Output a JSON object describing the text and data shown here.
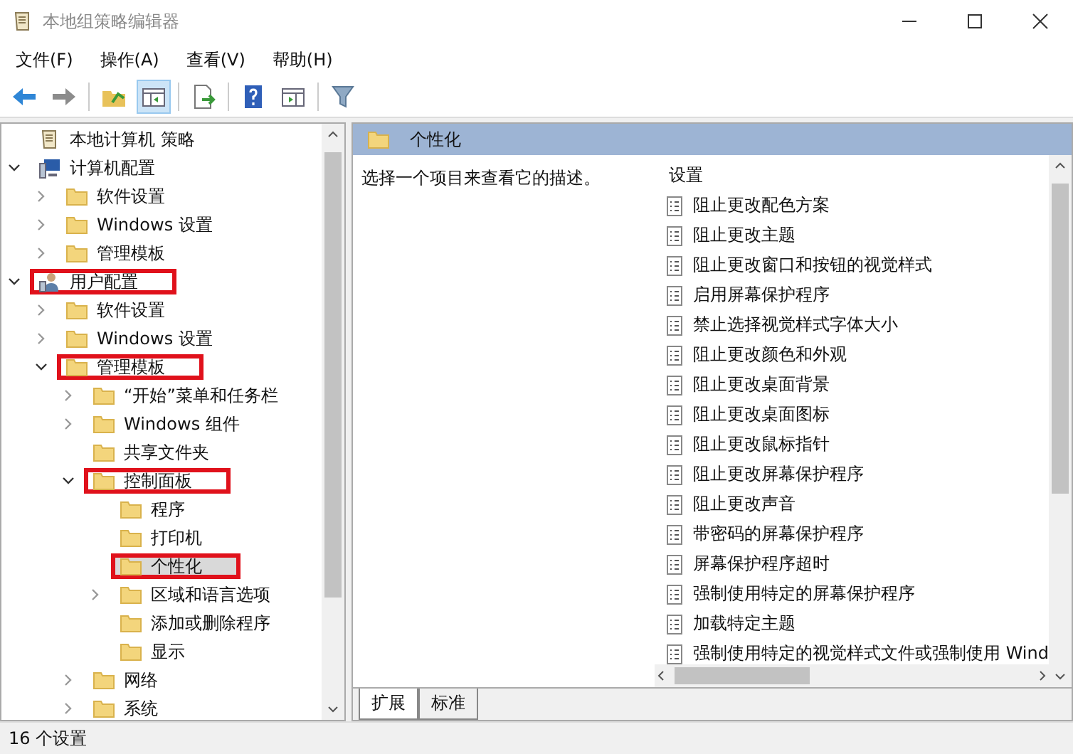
{
  "window": {
    "title": "本地组策略编辑器"
  },
  "menu": [
    "文件(F)",
    "操作(A)",
    "查看(V)",
    "帮助(H)"
  ],
  "toolbar": [
    {
      "kind": "back"
    },
    {
      "kind": "forward"
    },
    {
      "kind": "sep"
    },
    {
      "kind": "up"
    },
    {
      "kind": "tree",
      "selected": true
    },
    {
      "kind": "sep"
    },
    {
      "kind": "export"
    },
    {
      "kind": "sep"
    },
    {
      "kind": "help"
    },
    {
      "kind": "panel"
    },
    {
      "kind": "sep"
    },
    {
      "kind": "filter"
    }
  ],
  "tree": [
    {
      "label": "本地计算机 策略",
      "kind": "policy",
      "selected": false,
      "highlighted": false
    },
    {
      "label": "计算机配置",
      "kind": "computer",
      "expanded": true,
      "selected": false,
      "highlighted": false,
      "children": [
        {
          "label": "软件设置",
          "kind": "folder",
          "expanded": false,
          "selected": false,
          "highlighted": false
        },
        {
          "label": "Windows 设置",
          "kind": "folder",
          "expanded": false,
          "selected": false,
          "highlighted": false
        },
        {
          "label": "管理模板",
          "kind": "folder",
          "expanded": false,
          "selected": false,
          "highlighted": false
        }
      ]
    },
    {
      "label": "用户配置",
      "kind": "user",
      "expanded": true,
      "selected": false,
      "highlighted": true,
      "children": [
        {
          "label": "软件设置",
          "kind": "folder",
          "expanded": false,
          "selected": false,
          "highlighted": false
        },
        {
          "label": "Windows 设置",
          "kind": "folder",
          "expanded": false,
          "selected": false,
          "highlighted": false
        },
        {
          "label": "管理模板",
          "kind": "folder",
          "expanded": true,
          "selected": false,
          "highlighted": true,
          "children": [
            {
              "label": "“开始”菜单和任务栏",
              "kind": "folder",
              "expanded": false,
              "selected": false,
              "highlighted": false
            },
            {
              "label": "Windows 组件",
              "kind": "folder",
              "expanded": false,
              "selected": false,
              "highlighted": false
            },
            {
              "label": "共享文件夹",
              "kind": "folder",
              "selected": false,
              "highlighted": false
            },
            {
              "label": "控制面板",
              "kind": "folder",
              "expanded": true,
              "selected": false,
              "highlighted": true,
              "children": [
                {
                  "label": "程序",
                  "kind": "folder",
                  "selected": false,
                  "highlighted": false
                },
                {
                  "label": "打印机",
                  "kind": "folder",
                  "selected": false,
                  "highlighted": false
                },
                {
                  "label": "个性化",
                  "kind": "folder",
                  "selected": true,
                  "highlighted": true
                },
                {
                  "label": "区域和语言选项",
                  "kind": "folder",
                  "expanded": false,
                  "selected": false,
                  "highlighted": false
                },
                {
                  "label": "添加或删除程序",
                  "kind": "folder",
                  "selected": false,
                  "highlighted": false
                },
                {
                  "label": "显示",
                  "kind": "folder",
                  "selected": false,
                  "highlighted": false
                }
              ]
            },
            {
              "label": "网络",
              "kind": "folder",
              "expanded": false,
              "selected": false,
              "highlighted": false
            },
            {
              "label": "系统",
              "kind": "folder",
              "expanded": false,
              "selected": false,
              "highlighted": false
            }
          ]
        }
      ]
    }
  ],
  "details": {
    "title": "个性化",
    "description": "选择一个项目来查看它的描述。",
    "column": "设置",
    "settings": [
      "阻止更改配色方案",
      "阻止更改主题",
      "阻止更改窗口和按钮的视觉样式",
      "启用屏幕保护程序",
      "禁止选择视觉样式字体大小",
      "阻止更改颜色和外观",
      "阻止更改桌面背景",
      "阻止更改桌面图标",
      "阻止更改鼠标指针",
      "阻止更改屏幕保护程序",
      "阻止更改声音",
      "带密码的屏幕保护程序",
      "屏幕保护程序超时",
      "强制使用特定的屏幕保护程序",
      "加载特定主题",
      "强制使用特定的视觉样式文件或强制使用 Wind"
    ]
  },
  "tabs": [
    {
      "label": "扩展",
      "selected": true
    },
    {
      "label": "标准",
      "selected": false
    }
  ],
  "status_bar": "16 个设置"
}
